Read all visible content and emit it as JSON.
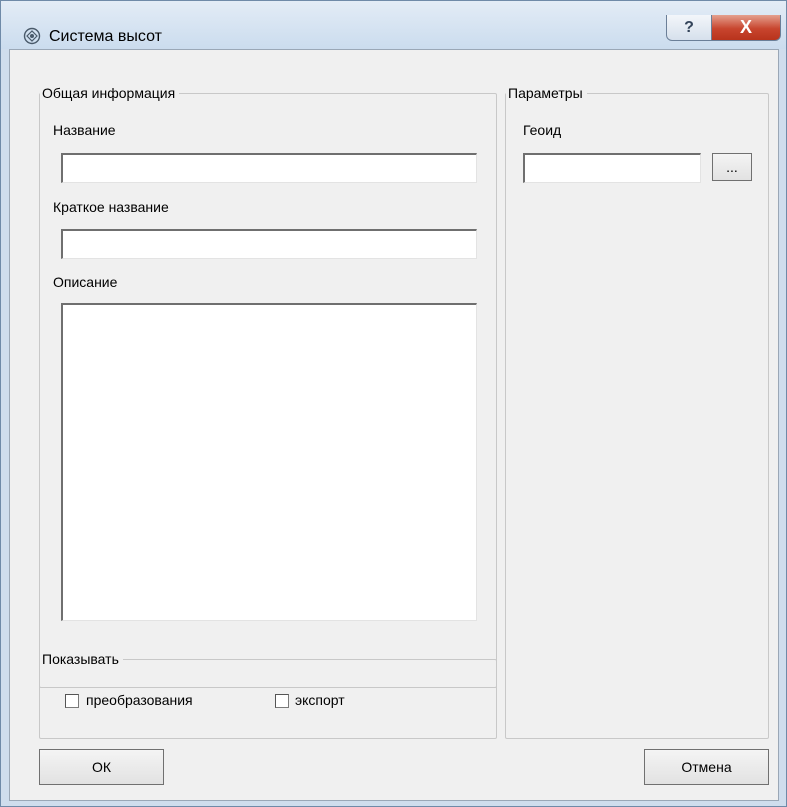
{
  "window": {
    "title": "Система высот",
    "help_glyph": "?",
    "close_glyph": "X"
  },
  "general": {
    "legend": "Общая информация",
    "name_label": "Название",
    "name_value": "",
    "short_name_label": "Краткое название",
    "short_name_value": "",
    "description_label": "Описание",
    "description_value": ""
  },
  "params": {
    "legend": "Параметры",
    "geoid_label": "Геоид",
    "geoid_value": "",
    "browse_label": "..."
  },
  "show": {
    "legend": "Показывать",
    "transform_label": "преобразования",
    "export_label": "экспорт"
  },
  "buttons": {
    "ok": "ОК",
    "cancel": "Отмена"
  }
}
